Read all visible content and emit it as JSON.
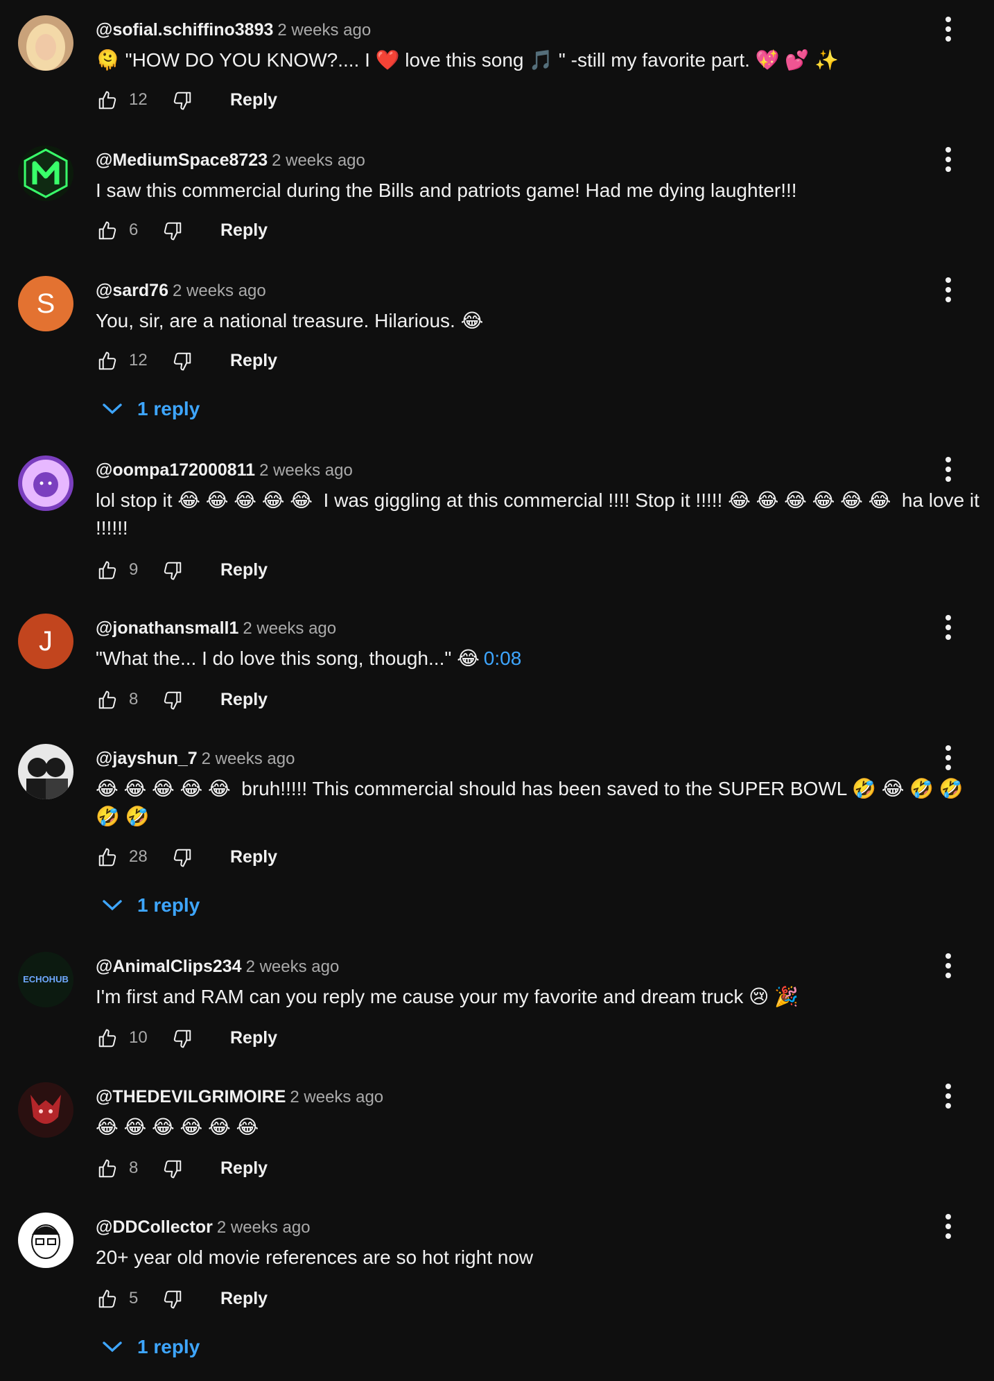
{
  "comments": [
    {
      "author": "@sofial.schiffino3893",
      "time": "2 weeks ago",
      "text": "🫠 \"HOW DO YOU KNOW?.... I ❤️ love this song 🎵 \" -still my favorite part. 💖 💕 ✨",
      "likes": "12",
      "reply_label": "Reply",
      "avatar": {
        "type": "photo",
        "icon": "blonde-woman-photo",
        "colors": [
          "#c9a27a",
          "#f3d9a8"
        ]
      }
    },
    {
      "author": "@MediumSpace8723",
      "time": "2 weeks ago",
      "text": "I saw this commercial during the Bills and patriots game! Had me dying laughter!!!",
      "likes": "6",
      "reply_label": "Reply",
      "avatar": {
        "type": "photo",
        "icon": "green-m-logo",
        "colors": [
          "#0b1a0b",
          "#39ff6a"
        ]
      }
    },
    {
      "author": "@sard76",
      "time": "2 weeks ago",
      "text": "You, sir, are a national treasure. Hilarious. 😂",
      "likes": "12",
      "reply_label": "Reply",
      "avatar": {
        "type": "letter",
        "letter": "S",
        "color": "#e37231"
      },
      "replies_label": "1 reply"
    },
    {
      "author": "@oompa172000811",
      "time": "2 weeks ago",
      "text": "lol stop it 😂 😂 😂 😂 😂  I was giggling at this commercial !!!! Stop it !!!!! 😂 😂 😂 😂 😂 😂  ha love it !!!!!!",
      "likes": "9",
      "reply_label": "Reply",
      "avatar": {
        "type": "photo",
        "icon": "purple-lion-logo",
        "colors": [
          "#7b3fbf",
          "#e7b8ff"
        ]
      }
    },
    {
      "author": "@jonathansmall1",
      "time": "2 weeks ago",
      "text": "\"What the... I do love this song, though...\" 😂",
      "timestamp_link": "0:08",
      "likes": "8",
      "reply_label": "Reply",
      "avatar": {
        "type": "letter",
        "letter": "J",
        "color": "#c2451e"
      }
    },
    {
      "author": "@jayshun_7",
      "time": "2 weeks ago",
      "text": "😂 😂 😂 😂 😂  bruh!!!!! This commercial should has been saved to the SUPER BOWL 🤣 😂 🤣 🤣 🤣 🤣",
      "likes": "28",
      "reply_label": "Reply",
      "avatar": {
        "type": "photo",
        "icon": "two-people-photo",
        "colors": [
          "#e8e8e8",
          "#1a1a1a"
        ]
      },
      "replies_label": "1 reply"
    },
    {
      "author": "@AnimalClips234",
      "time": "2 weeks ago",
      "text": "I'm first and RAM can you reply me cause your my favorite and dream truck 😢 🎉",
      "likes": "10",
      "reply_label": "Reply",
      "avatar": {
        "type": "logo",
        "label": "ECHOHUB",
        "icon": "echohub-logo",
        "colors": [
          "#0c1a10",
          "#6fa8ff"
        ]
      }
    },
    {
      "author": "@THEDEVILGRIMOIRE",
      "time": "2 weeks ago",
      "text": "😂 😂 😂 😂 😂 😂",
      "likes": "8",
      "reply_label": "Reply",
      "avatar": {
        "type": "photo",
        "icon": "red-demon-photo",
        "colors": [
          "#2a1010",
          "#b3262a"
        ]
      }
    },
    {
      "author": "@DDCollector",
      "time": "2 weeks ago",
      "text": "20+ year old movie references are so hot right now",
      "likes": "5",
      "reply_label": "Reply",
      "avatar": {
        "type": "photo",
        "icon": "cartoon-man-glasses",
        "colors": [
          "#ffffff",
          "#111111"
        ]
      },
      "replies_label": "1 reply"
    }
  ],
  "colors": {
    "background": "#0f0f0f",
    "primary_text": "#f1f1f1",
    "secondary_text": "#aaaaaa",
    "link": "#3ea6ff"
  },
  "icons": {
    "like": "thumbs-up-icon",
    "dislike": "thumbs-down-icon",
    "more": "more-vert-icon",
    "expand": "chevron-down-icon"
  }
}
